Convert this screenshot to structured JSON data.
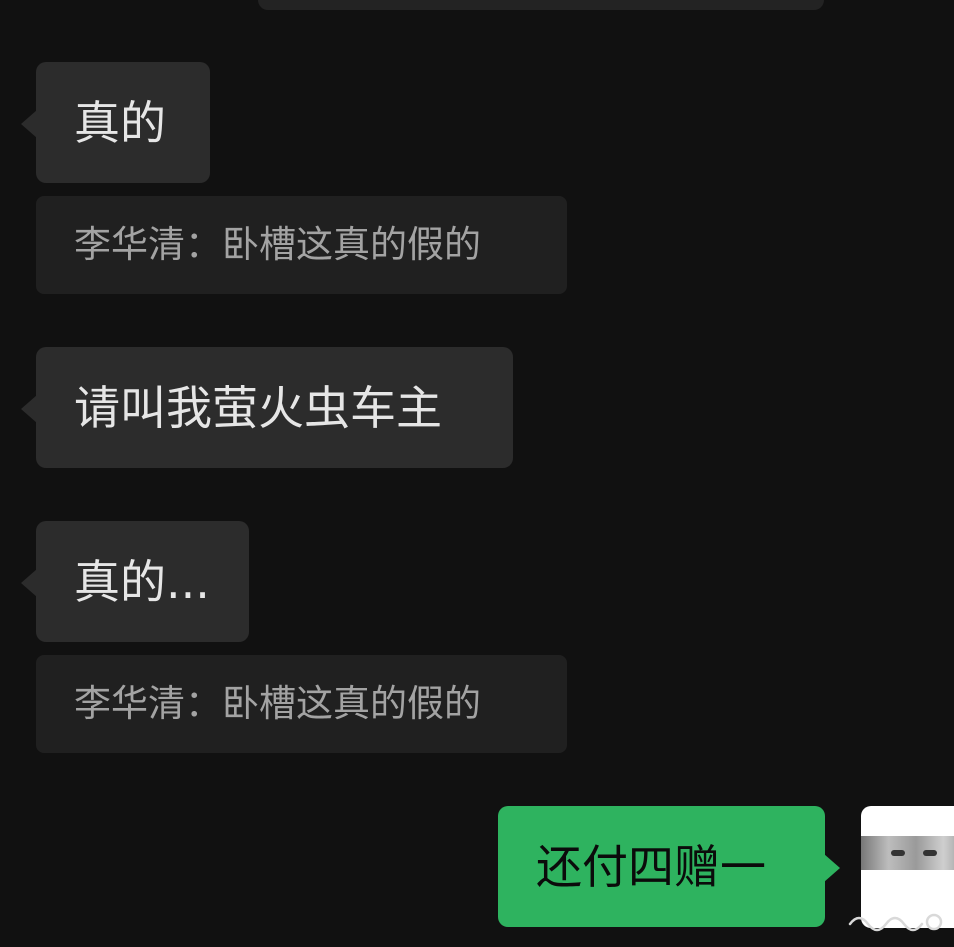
{
  "messages": [
    {
      "type": "received",
      "text": "真的"
    },
    {
      "type": "quote",
      "text": "李华清：卧槽这真的假的"
    },
    {
      "type": "received",
      "text": "请叫我萤火虫车主"
    },
    {
      "type": "received",
      "text": "真的..."
    },
    {
      "type": "quote",
      "text": "李华清：卧槽这真的假的"
    },
    {
      "type": "sent",
      "text": "还付四赠一"
    }
  ],
  "colors": {
    "background": "#111111",
    "received_bubble": "#2c2c2c",
    "quote_block": "#202020",
    "sent_bubble": "#2eb35f"
  },
  "icons": {
    "avatar": "avatar-photo",
    "watermark": "watermark-logo"
  }
}
